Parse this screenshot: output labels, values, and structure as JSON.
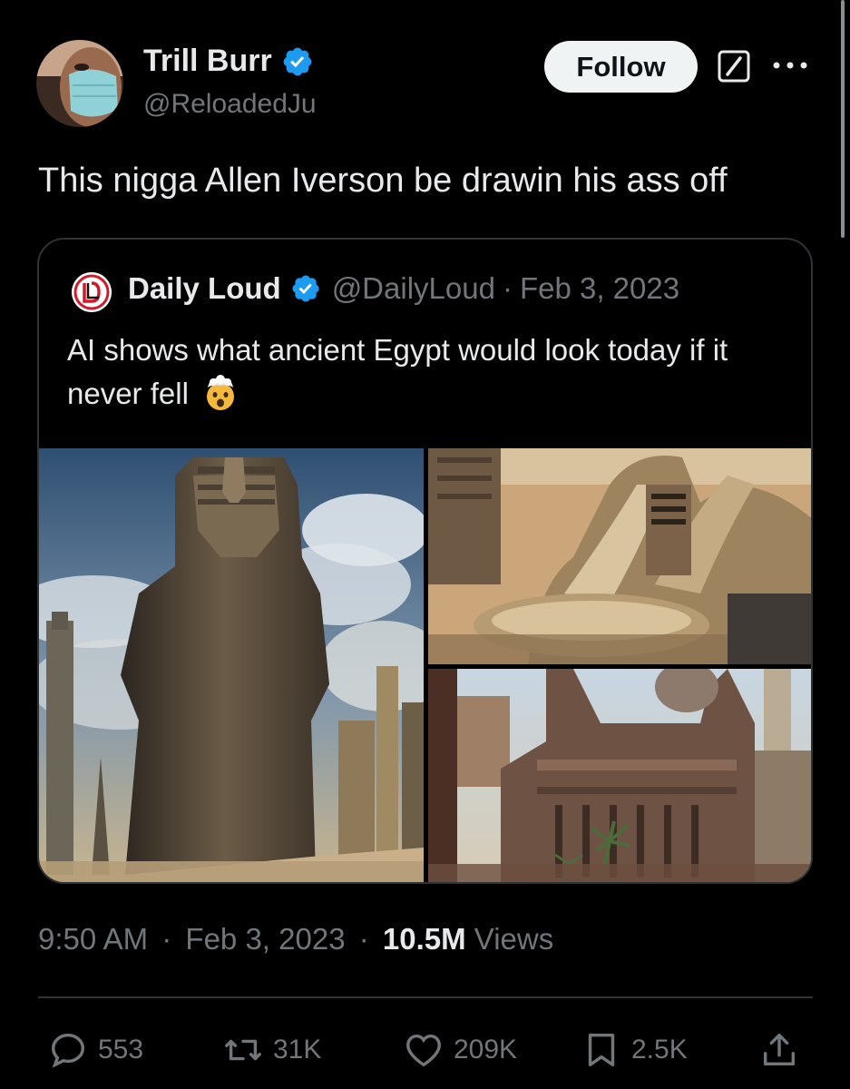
{
  "tweet": {
    "author_name": "Trill Burr",
    "author_handle": "@ReloadedJu",
    "follow_label": "Follow",
    "text": "This nigga Allen Iverson be drawin his ass off",
    "timestamp_time": "9:50 AM",
    "separator": "·",
    "timestamp_date": "Feb 3, 2023",
    "views_count": "10.5M",
    "views_label": "Views"
  },
  "quoted_tweet": {
    "author_name": "Daily Loud",
    "author_handle": "@DailyLoud",
    "separator": "·",
    "date": "Feb 3, 2023",
    "text": "AI shows what ancient Egypt would look today if it never fell",
    "emoji": "exploding-head-emoji",
    "images": [
      "pharaoh-statue-city-image",
      "egyptian-futuristic-building-image",
      "egyptian-temple-city-image"
    ]
  },
  "actions": {
    "replies": "553",
    "retweets": "31K",
    "likes": "209K",
    "bookmarks": "2.5K"
  },
  "icons": {
    "verified": "verified-badge-icon",
    "grok": "grok-icon",
    "more": "more-options-icon",
    "reply": "reply-icon",
    "retweet": "retweet-icon",
    "like": "heart-icon",
    "bookmark": "bookmark-icon",
    "share": "share-icon"
  },
  "colors": {
    "background": "#000000",
    "text_primary": "#e7e9ea",
    "text_secondary": "#71767b",
    "verified": "#1d9bf0",
    "follow_button_bg": "#eff3f4",
    "border": "#2f3336"
  }
}
